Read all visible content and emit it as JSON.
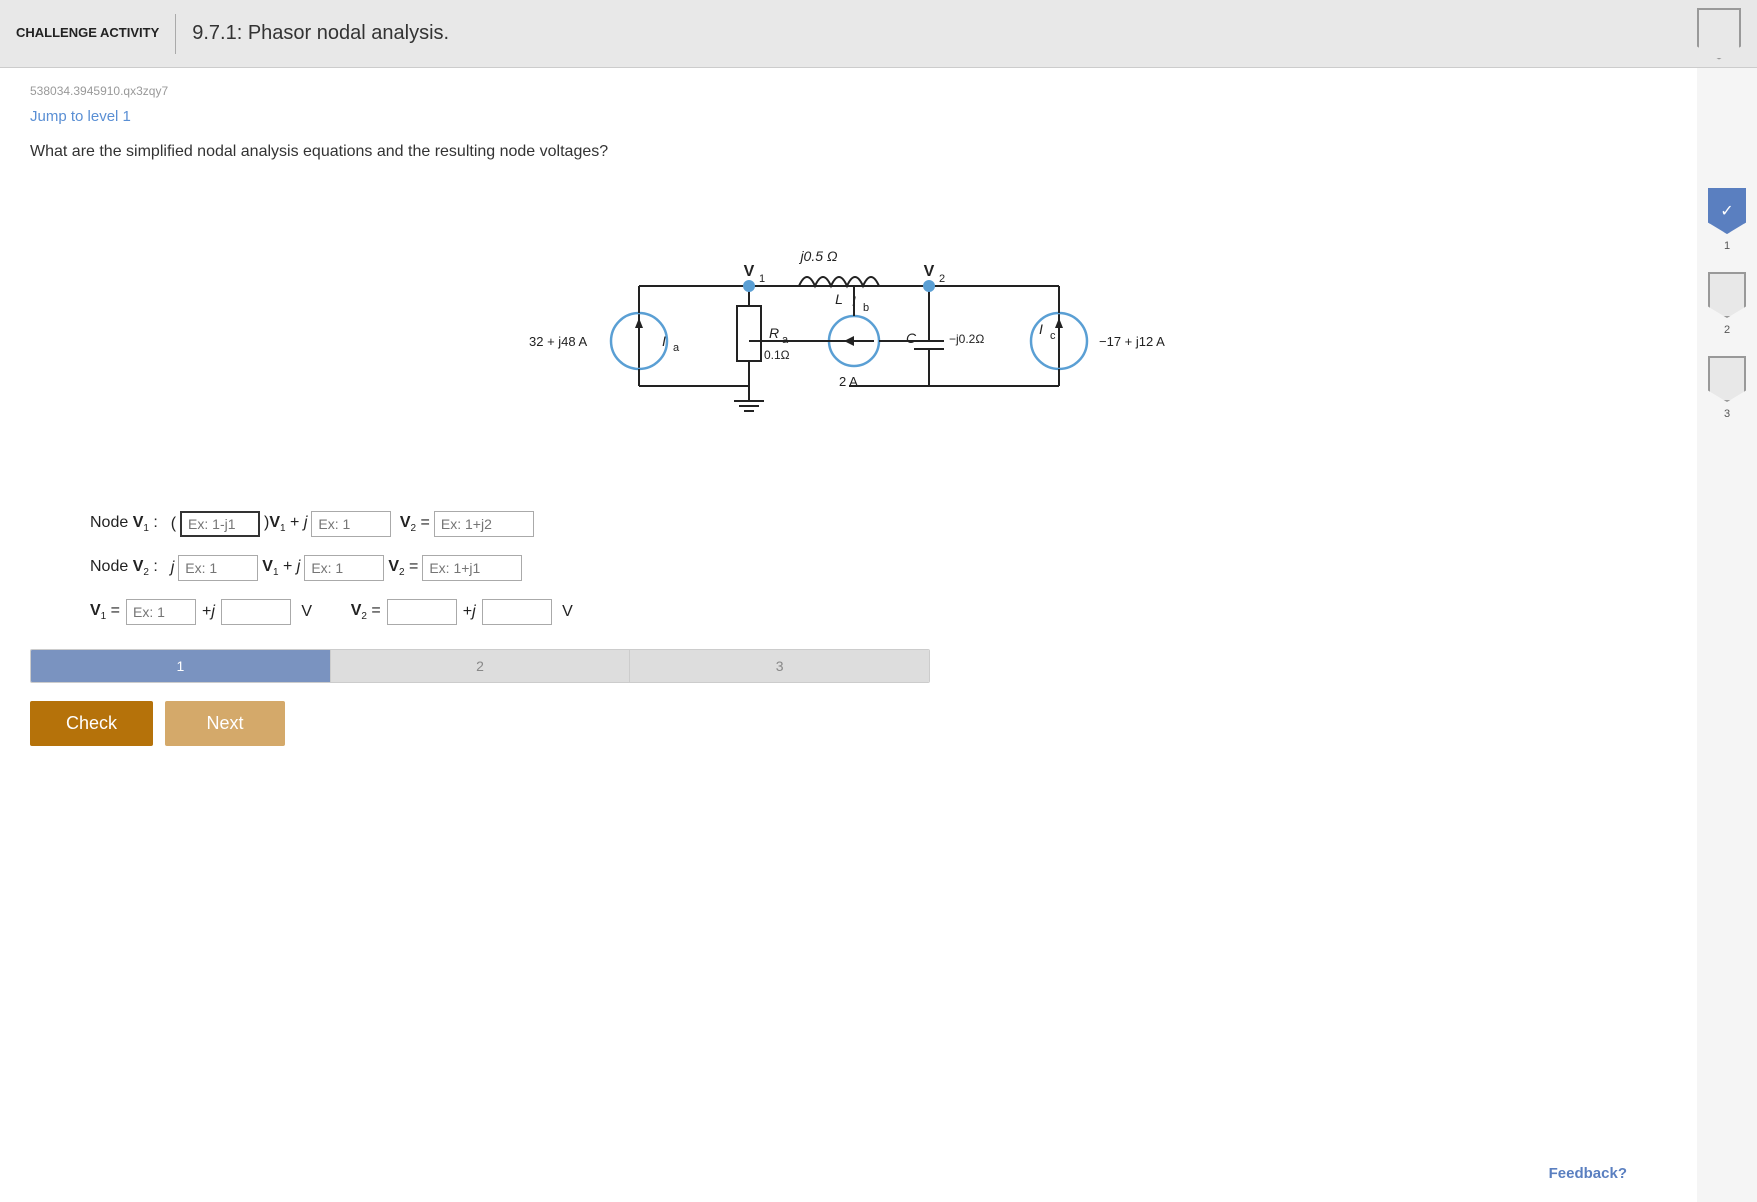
{
  "header": {
    "challenge_label": "CHALLENGE ACTIVITY",
    "activity_title": "9.7.1: Phasor nodal analysis.",
    "badge_icon": "shield"
  },
  "activity_id": "538034.3945910.qx3zqy7",
  "jump_link": "Jump to level 1",
  "question": "What are the simplified nodal analysis equations and the resulting node voltages?",
  "levels": [
    {
      "number": "1",
      "active": true
    },
    {
      "number": "2",
      "active": false
    },
    {
      "number": "3",
      "active": false
    }
  ],
  "equations": {
    "node_v1_label": "Node V",
    "node_v1_sub": "1",
    "node_v1_coeff_placeholder": "Ex: 1-j1",
    "node_v1_j_placeholder": "Ex: 1",
    "node_v1_rhs_placeholder": "Ex: 1+j2",
    "node_v2_label": "Node V",
    "node_v2_sub": "2",
    "node_v2_j1_placeholder": "Ex: 1",
    "node_v2_j2_placeholder": "Ex: 1",
    "node_v2_rhs_placeholder": "Ex: 1+j1",
    "v1_real_placeholder": "Ex: 1",
    "v1_imag_placeholder": "",
    "v2_real_placeholder": "",
    "v2_imag_placeholder": ""
  },
  "progress_bar": {
    "segments": [
      "1",
      "2",
      "3"
    ]
  },
  "buttons": {
    "check_label": "Check",
    "next_label": "Next"
  },
  "feedback": "Feedback?"
}
